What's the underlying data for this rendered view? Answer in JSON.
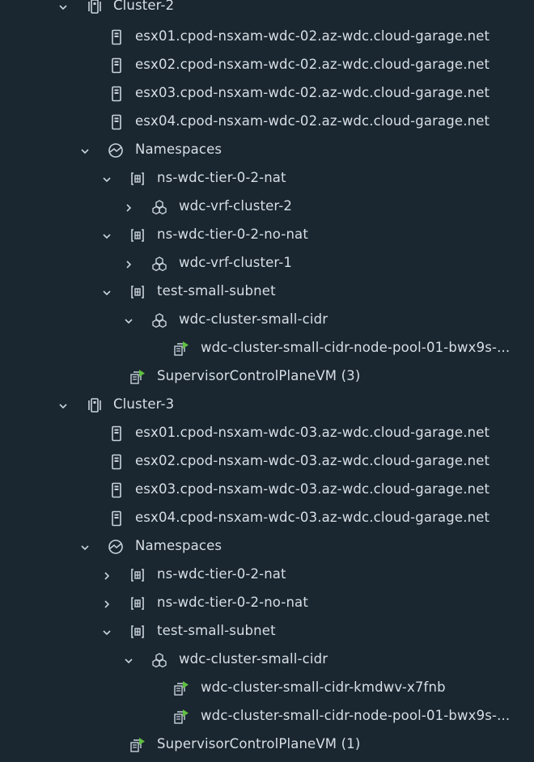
{
  "tree": {
    "cluster2": {
      "label": "Cluster-2",
      "hosts": [
        "esx01.cpod-nsxam-wdc-02.az-wdc.cloud-garage.net",
        "esx02.cpod-nsxam-wdc-02.az-wdc.cloud-garage.net",
        "esx03.cpod-nsxam-wdc-02.az-wdc.cloud-garage.net",
        "esx04.cpod-nsxam-wdc-02.az-wdc.cloud-garage.net"
      ],
      "namespaces_label": "Namespaces",
      "ns": [
        {
          "label": "ns-wdc-tier-0-2-nat",
          "child": "wdc-vrf-cluster-2"
        },
        {
          "label": "ns-wdc-tier-0-2-no-nat",
          "child": "wdc-vrf-cluster-1"
        },
        {
          "label": "test-small-subnet",
          "child": "wdc-cluster-small-cidr",
          "vms": [
            "wdc-cluster-small-cidr-node-pool-01-bwx9s-..."
          ]
        }
      ],
      "supervisor": "SupervisorControlPlaneVM (3)"
    },
    "cluster3": {
      "label": "Cluster-3",
      "hosts": [
        "esx01.cpod-nsxam-wdc-03.az-wdc.cloud-garage.net",
        "esx02.cpod-nsxam-wdc-03.az-wdc.cloud-garage.net",
        "esx03.cpod-nsxam-wdc-03.az-wdc.cloud-garage.net",
        "esx04.cpod-nsxam-wdc-03.az-wdc.cloud-garage.net"
      ],
      "namespaces_label": "Namespaces",
      "ns": [
        {
          "label": "ns-wdc-tier-0-2-nat"
        },
        {
          "label": "ns-wdc-tier-0-2-no-nat"
        },
        {
          "label": "test-small-subnet",
          "child": "wdc-cluster-small-cidr",
          "vms": [
            "wdc-cluster-small-cidr-kmdwv-x7fnb",
            "wdc-cluster-small-cidr-node-pool-01-bwx9s-..."
          ]
        }
      ],
      "supervisor": "SupervisorControlPlaneVM (1)"
    }
  },
  "colors": {
    "background": "#1a2630",
    "text": "#d7dfe5",
    "icon": "#c9d3db",
    "vm_power_on": "#5fbf3f"
  }
}
